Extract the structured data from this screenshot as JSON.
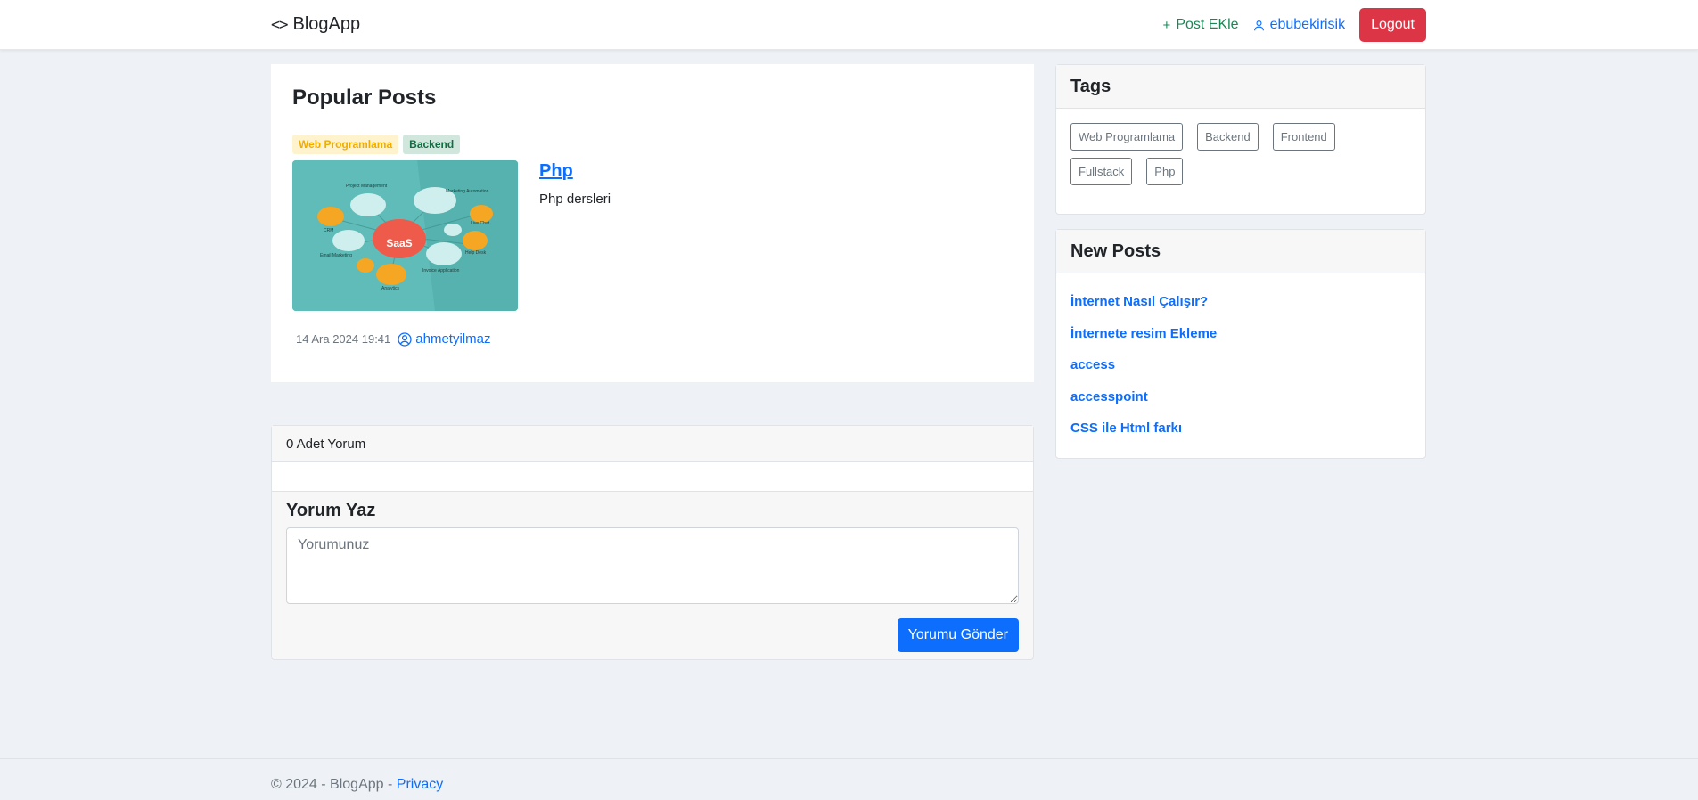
{
  "navbar": {
    "brand": "BlogApp",
    "add_post": "Post EKle",
    "username": "ebubekirisik",
    "logout": "Logout"
  },
  "popular": {
    "title": "Popular Posts",
    "tags": [
      "Web Programlama",
      "Backend"
    ],
    "post": {
      "title": "Php",
      "description": "Php dersleri",
      "date": "14 Ara 2024 19:41",
      "author": "ahmetyilmaz",
      "image_labels": {
        "center": "SaaS",
        "project": "Project Management",
        "marketing": "Marketing Automation",
        "crm": "CRM",
        "livechat": "Live Chat",
        "email": "Email Marketing",
        "helpdesk": "Help Desk",
        "analytics": "Analytics",
        "invoice": "Invoice Application"
      }
    }
  },
  "comments": {
    "count_label": "0 Adet Yorum",
    "write_title": "Yorum Yaz",
    "placeholder": "Yorumunuz",
    "submit": "Yorumu Gönder"
  },
  "sidebar": {
    "tags_title": "Tags",
    "tags": [
      "Web Programlama",
      "Backend",
      "Frontend",
      "Fullstack",
      "Php"
    ],
    "new_posts_title": "New Posts",
    "new_posts": [
      "İnternet Nasıl Çalışır?",
      "İnternete resim Ekleme",
      "access",
      "accesspoint",
      "CSS ile Html farkı"
    ]
  },
  "footer": {
    "copyright": "© 2024 - BlogApp - ",
    "privacy": "Privacy"
  },
  "colors": {
    "primary": "#0d6efd",
    "success": "#198754",
    "danger": "#dc3545",
    "background": "#eef1f5"
  }
}
